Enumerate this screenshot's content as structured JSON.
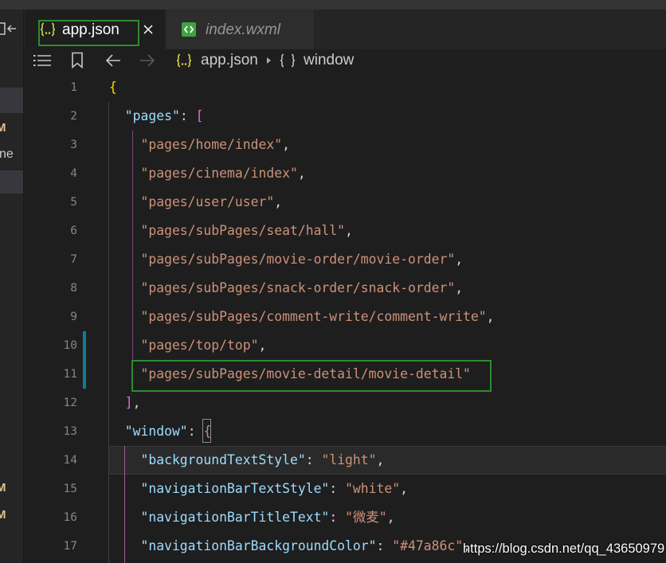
{
  "theme": {
    "editor_bg": "#1e1e1e",
    "key_color": "#9cdcfe",
    "string_color": "#ce9178",
    "punct_color": "#d4d4d4",
    "bracket1_color": "#ffd700",
    "bracket2_color": "#da70d6",
    "annotation_color": "#2e8b2e",
    "modified_badge_color": "#e2c08d",
    "gutter_change_color": "#0c7d9d"
  },
  "explorer": {
    "toggle_icon": "panel-collapse-icon",
    "badges": [
      "M",
      "M",
      "M"
    ],
    "partial_label": "ne"
  },
  "tabs": [
    {
      "label": "app.json",
      "icon": "json-file-icon",
      "close_icon": "close-icon",
      "active": true
    },
    {
      "label": "index.wxml",
      "icon": "wxml-file-icon",
      "active": false
    }
  ],
  "toolbar": {
    "icons": [
      "outline-list-icon",
      "bookmark-icon",
      "back-arrow-icon",
      "forward-arrow-icon"
    ]
  },
  "breadcrumb": {
    "file_icon": "json-file-icon",
    "file": "app.json",
    "separator_icon": "chevron-right-icon",
    "symbol_icon": "object-symbol-icon",
    "symbol": "window"
  },
  "editor": {
    "lines": [
      {
        "number": "1",
        "tokens": [
          "{"
        ]
      },
      {
        "number": "2",
        "tokens": [
          "\"pages\"",
          ": ",
          "["
        ]
      },
      {
        "number": "3",
        "tokens": [
          "\"pages/home/index\"",
          ","
        ]
      },
      {
        "number": "4",
        "tokens": [
          "\"pages/cinema/index\"",
          ","
        ]
      },
      {
        "number": "5",
        "tokens": [
          "\"pages/user/user\"",
          ","
        ]
      },
      {
        "number": "6",
        "tokens": [
          "\"pages/subPages/seat/hall\"",
          ","
        ]
      },
      {
        "number": "7",
        "tokens": [
          "\"pages/subPages/movie-order/movie-order\"",
          ","
        ]
      },
      {
        "number": "8",
        "tokens": [
          "\"pages/subPages/snack-order/snack-order\"",
          ","
        ]
      },
      {
        "number": "9",
        "tokens": [
          "\"pages/subPages/comment-write/comment-write\"",
          ","
        ]
      },
      {
        "number": "10",
        "tokens": [
          "\"pages/top/top\"",
          ","
        ]
      },
      {
        "number": "11",
        "tokens": [
          "\"pages/subPages/movie-detail/movie-detail\""
        ]
      },
      {
        "number": "12",
        "tokens": [
          "]",
          ","
        ]
      },
      {
        "number": "13",
        "tokens": [
          "\"window\"",
          ": ",
          "{"
        ]
      },
      {
        "number": "14",
        "tokens": [
          "\"backgroundTextStyle\"",
          ": ",
          "\"light\"",
          ","
        ]
      },
      {
        "number": "15",
        "tokens": [
          "\"navigationBarTextStyle\"",
          ": ",
          "\"white\"",
          ","
        ]
      },
      {
        "number": "16",
        "tokens": [
          "\"navigationBarTitleText\"",
          ": ",
          "\"微麦\"",
          ","
        ]
      },
      {
        "number": "17",
        "tokens": [
          "\"navigationBarBackgroundColor\"",
          ": ",
          "\"#47a86c\"",
          ","
        ]
      }
    ]
  },
  "watermark": "https://blog.csdn.net/qq_43650979"
}
